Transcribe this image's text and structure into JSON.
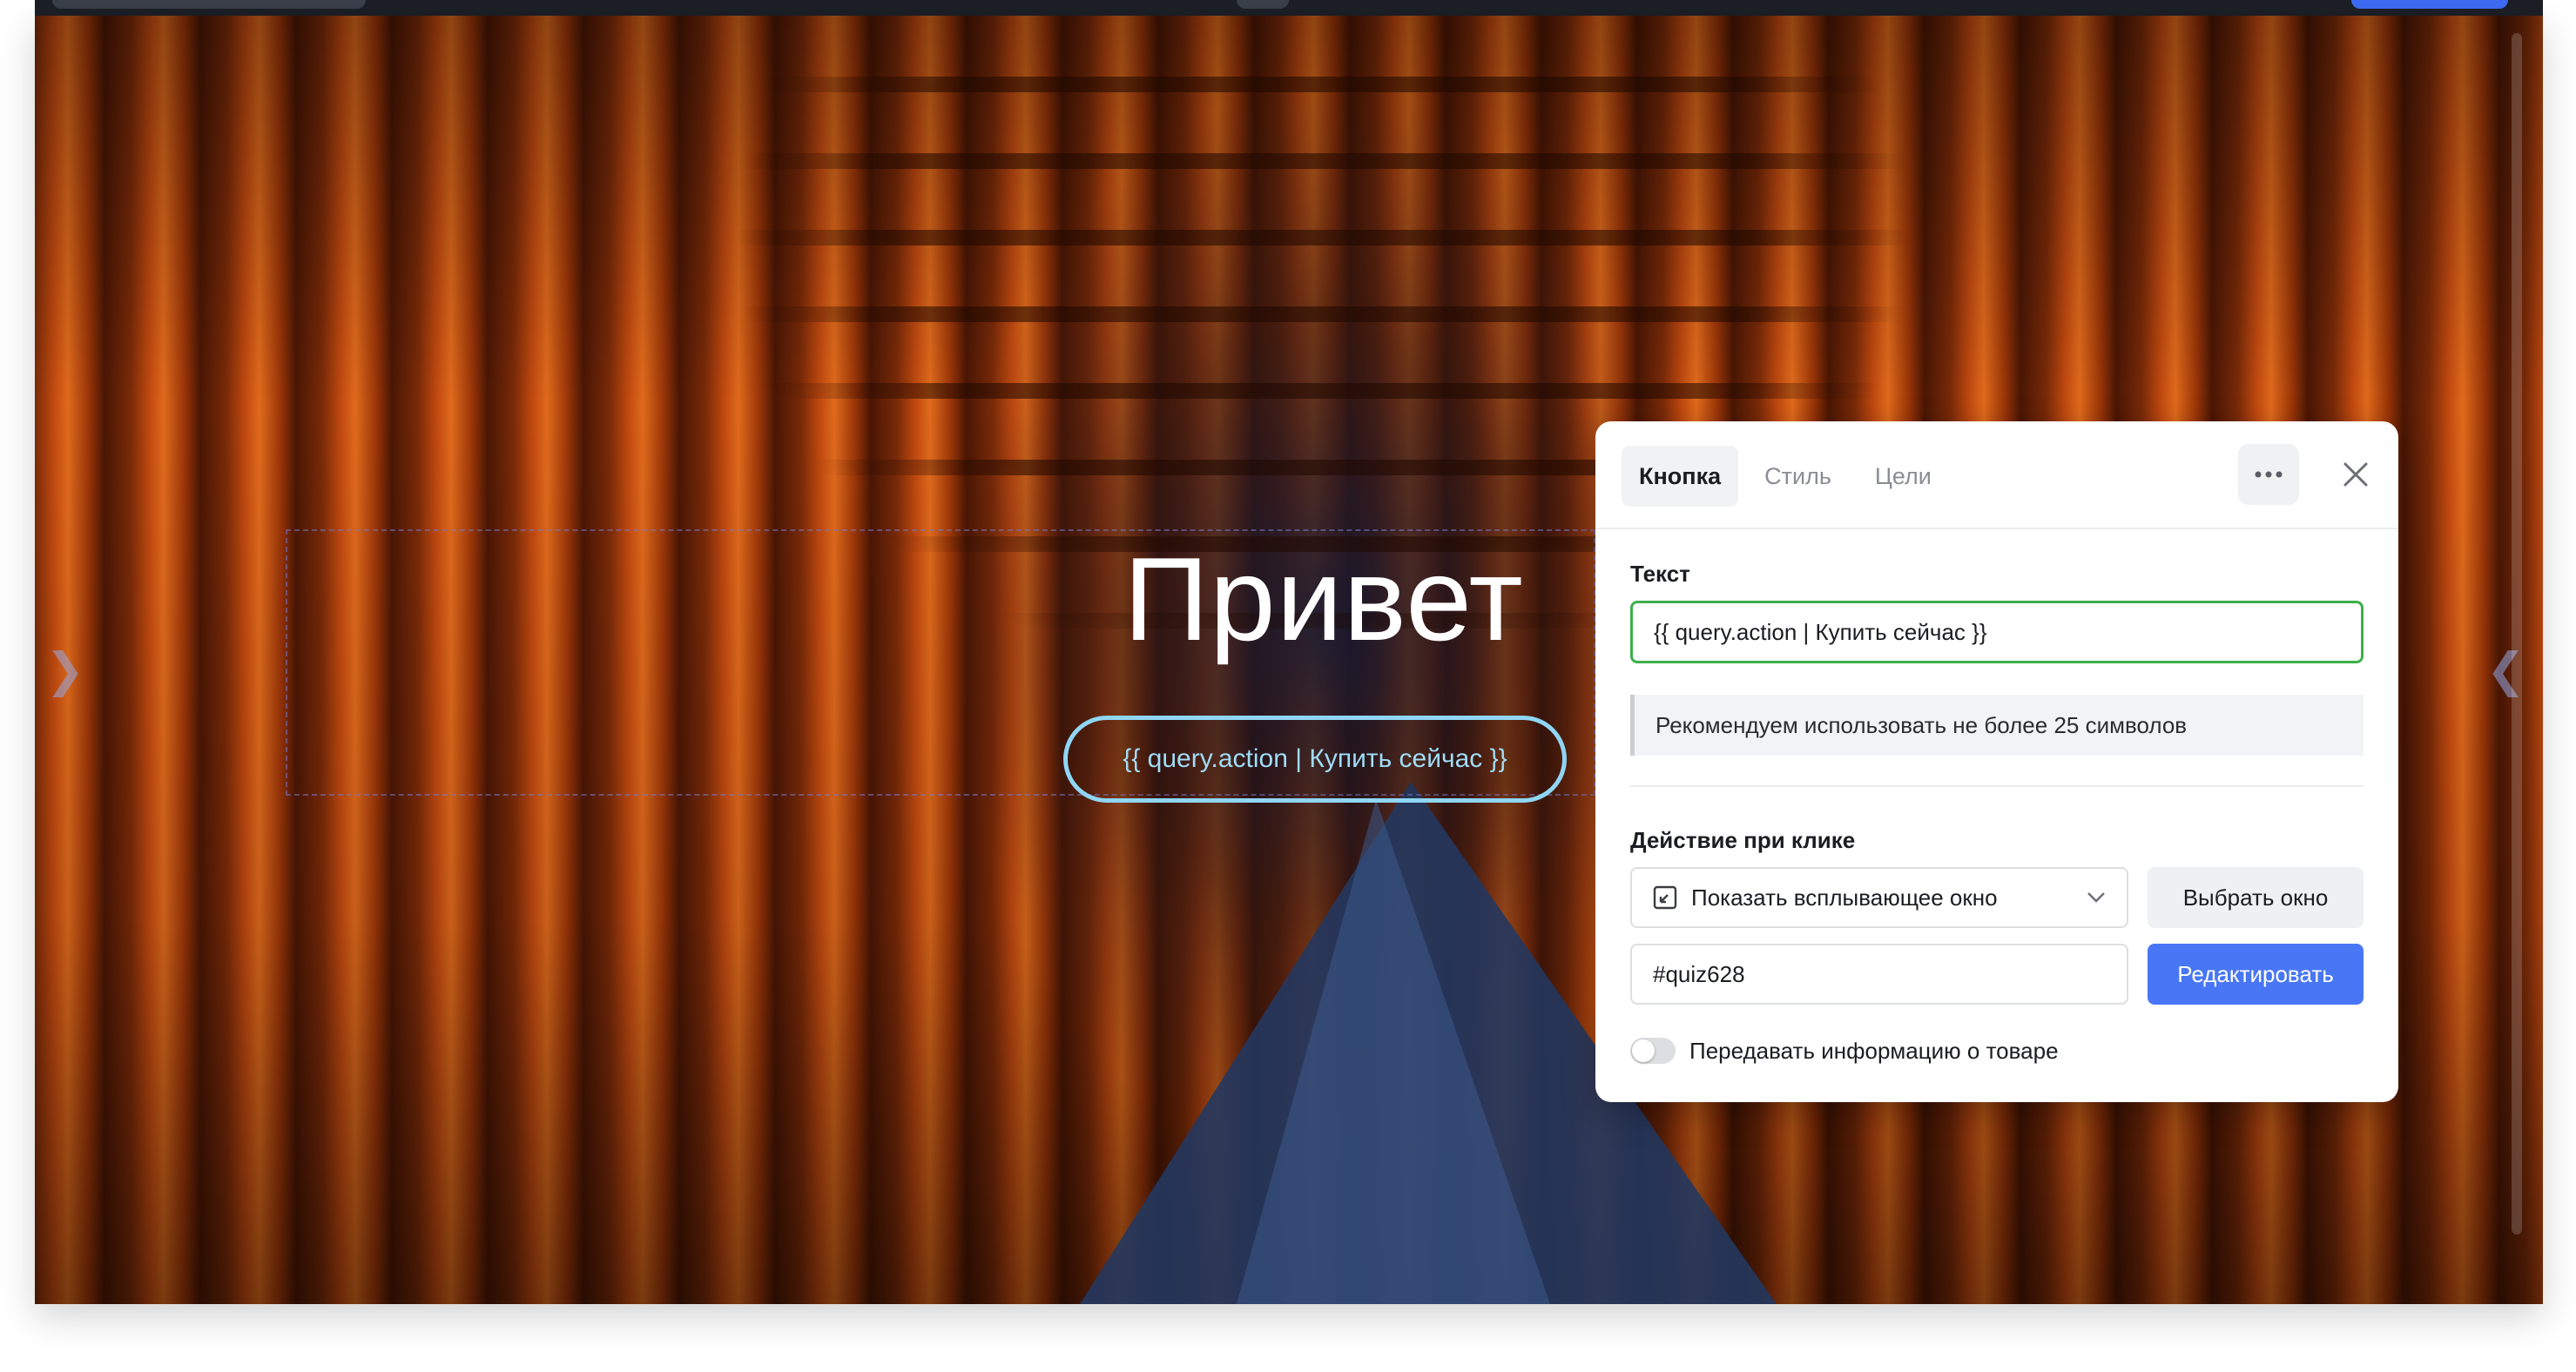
{
  "hero": {
    "title": "Привет",
    "button_text": "{{ query.action | Купить сейчас }}"
  },
  "panel": {
    "tabs": [
      {
        "label": "Кнопка",
        "active": true
      },
      {
        "label": "Стиль",
        "active": false
      },
      {
        "label": "Цели",
        "active": false
      }
    ],
    "more_icon": "more-horizontal-icon",
    "close_icon": "close-icon",
    "text_label": "Текст",
    "text_value": "{{ query.action | Купить сейчас }}",
    "hint": "Рекомендуем использовать не более 25 символов",
    "action_label": "Действие при клике",
    "action_select": "Показать всплывающее окно",
    "select_window_button": "Выбрать окно",
    "popup_id_value": "#quiz628",
    "edit_button": "Редактировать",
    "toggle_label": "Передавать информацию о товаре",
    "toggle_on": false
  },
  "colors": {
    "accent": "#4876f5",
    "input_focus": "#3daf4a",
    "hero_button": "#8fd6f5"
  }
}
